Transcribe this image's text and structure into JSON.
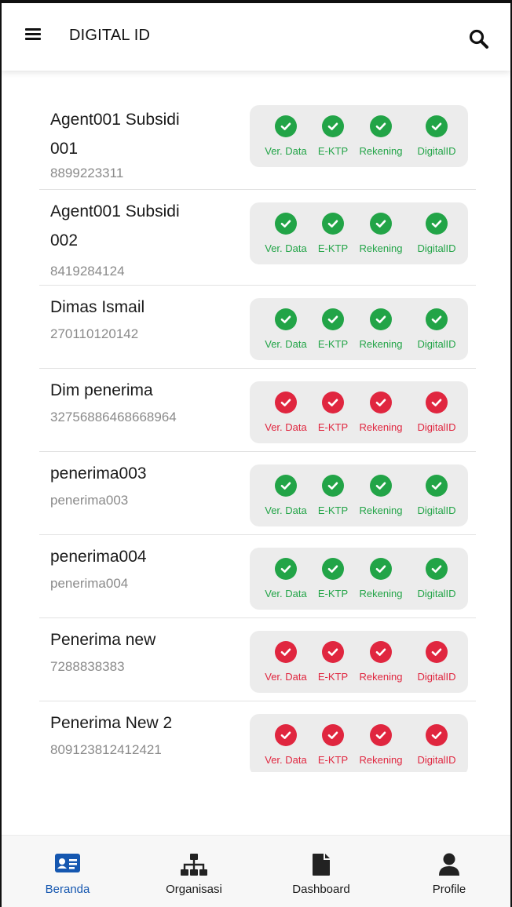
{
  "header": {
    "title": "DIGITAL ID",
    "menu_icon": "hamburger-menu-icon",
    "search_icon": "search-icon"
  },
  "status_labels": [
    "Ver. Data",
    "E-KTP",
    "Rekening",
    "DigitalID"
  ],
  "colors": {
    "ok": "#22a447",
    "bad": "#e0263f",
    "active_nav": "#1557b0"
  },
  "items": [
    {
      "name": "Agent001 Subsidi 001",
      "id": "8899223311",
      "status": "ok"
    },
    {
      "name": "Agent001 Subsidi 002",
      "id": "8419284124",
      "status": "ok"
    },
    {
      "name": "Dimas Ismail",
      "id": "270110120142",
      "status": "ok"
    },
    {
      "name": "Dim penerima",
      "id": "32756886468668964",
      "status": "bad"
    },
    {
      "name": "penerima003",
      "id": "penerima003",
      "status": "ok"
    },
    {
      "name": "penerima004",
      "id": "penerima004",
      "status": "ok"
    },
    {
      "name": "Penerima new",
      "id": "7288838383",
      "status": "bad"
    },
    {
      "name": "Penerima New 2",
      "id": "809123812412421",
      "status": "bad"
    }
  ],
  "nav": [
    {
      "label": "Beranda",
      "icon": "id-card-icon",
      "active": true
    },
    {
      "label": "Organisasi",
      "icon": "org-chart-icon",
      "active": false
    },
    {
      "label": "Dashboard",
      "icon": "document-icon",
      "active": false
    },
    {
      "label": "Profile",
      "icon": "user-icon",
      "active": false
    }
  ]
}
